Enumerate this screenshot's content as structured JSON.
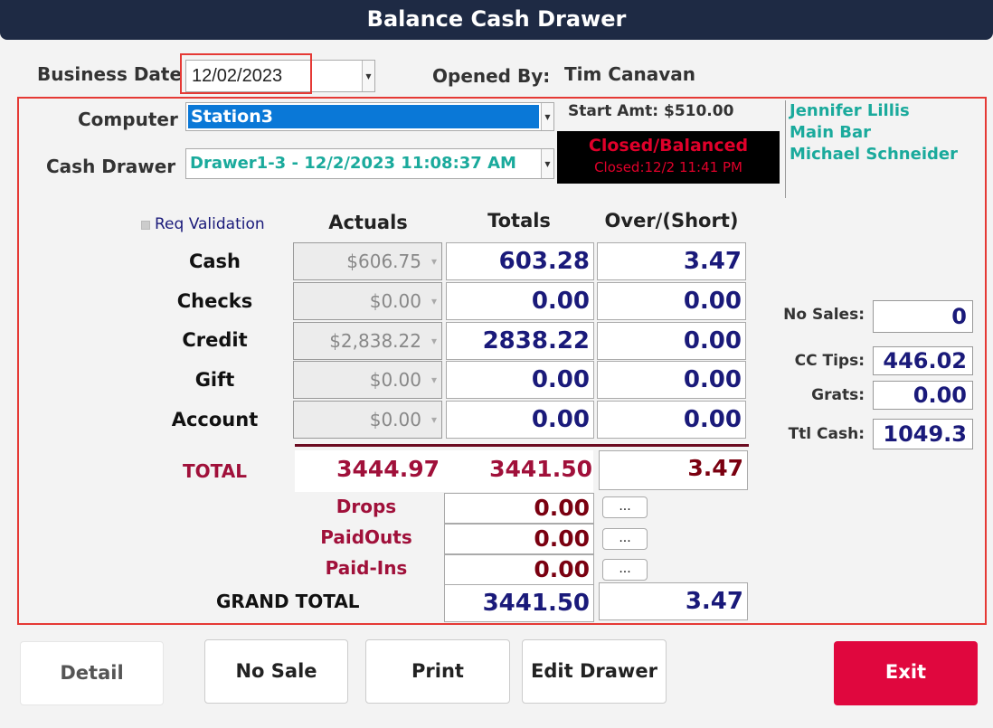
{
  "window": {
    "title": "Balance Cash Drawer"
  },
  "header": {
    "business_date_label": "Business Date",
    "business_date_value": "12/02/2023",
    "opened_by_label": "Opened By:",
    "opened_by_value": "Tim Canavan"
  },
  "drawer": {
    "computer_label": "Computer",
    "computer_value": "Station3",
    "cash_drawer_label": "Cash Drawer",
    "cash_drawer_value": "Drawer1-3 - 12/2/2023 11:08:37 AM",
    "start_amt": "Start Amt: $510.00",
    "status_title": "Closed/Balanced",
    "status_closed": "Closed:12/2 11:41 PM",
    "users": [
      "Jennifer Lillis",
      "Main Bar",
      "Michael Schneider"
    ]
  },
  "grid": {
    "req_validation": "Req Validation",
    "col_actuals": "Actuals",
    "col_totals": "Totals",
    "col_over_short": "Over/(Short)",
    "rows": [
      {
        "label": "Cash",
        "actual": "$606.75",
        "total": "603.28",
        "over": "3.47"
      },
      {
        "label": "Checks",
        "actual": "$0.00",
        "total": "0.00",
        "over": "0.00"
      },
      {
        "label": "Credit",
        "actual": "$2,838.22",
        "total": "2838.22",
        "over": "0.00"
      },
      {
        "label": "Gift",
        "actual": "$0.00",
        "total": "0.00",
        "over": "0.00"
      },
      {
        "label": "Account",
        "actual": "$0.00",
        "total": "0.00",
        "over": "0.00"
      }
    ],
    "total_label": "TOTAL",
    "total_actual": "3444.97",
    "total_totals": "3441.50",
    "total_over": "3.47",
    "drops_label": "Drops",
    "drops_value": "0.00",
    "paidouts_label": "PaidOuts",
    "paidouts_value": "0.00",
    "paidins_label": "Paid-Ins",
    "paidins_value": "0.00",
    "ellipsis": "...",
    "grand_total_label": "GRAND TOTAL",
    "grand_total_value": "3441.50",
    "grand_total_over": "3.47"
  },
  "side": {
    "no_sales_label": "No Sales:",
    "no_sales_value": "0",
    "cc_tips_label": "CC Tips:",
    "cc_tips_value": "446.02",
    "grats_label": "Grats:",
    "grats_value": "0.00",
    "ttl_cash_label": "Ttl Cash:",
    "ttl_cash_value": "1049.3"
  },
  "buttons": {
    "detail": "Detail",
    "no_sale": "No Sale",
    "print": "Print",
    "edit_drawer": "Edit Drawer",
    "exit": "Exit"
  },
  "colors": {
    "accent_red": "#e0073e",
    "title_bg": "#1e2a44",
    "teal": "#1aaa9c",
    "navy_value": "#1a1a7a",
    "selection_blue": "#0a78d7"
  }
}
